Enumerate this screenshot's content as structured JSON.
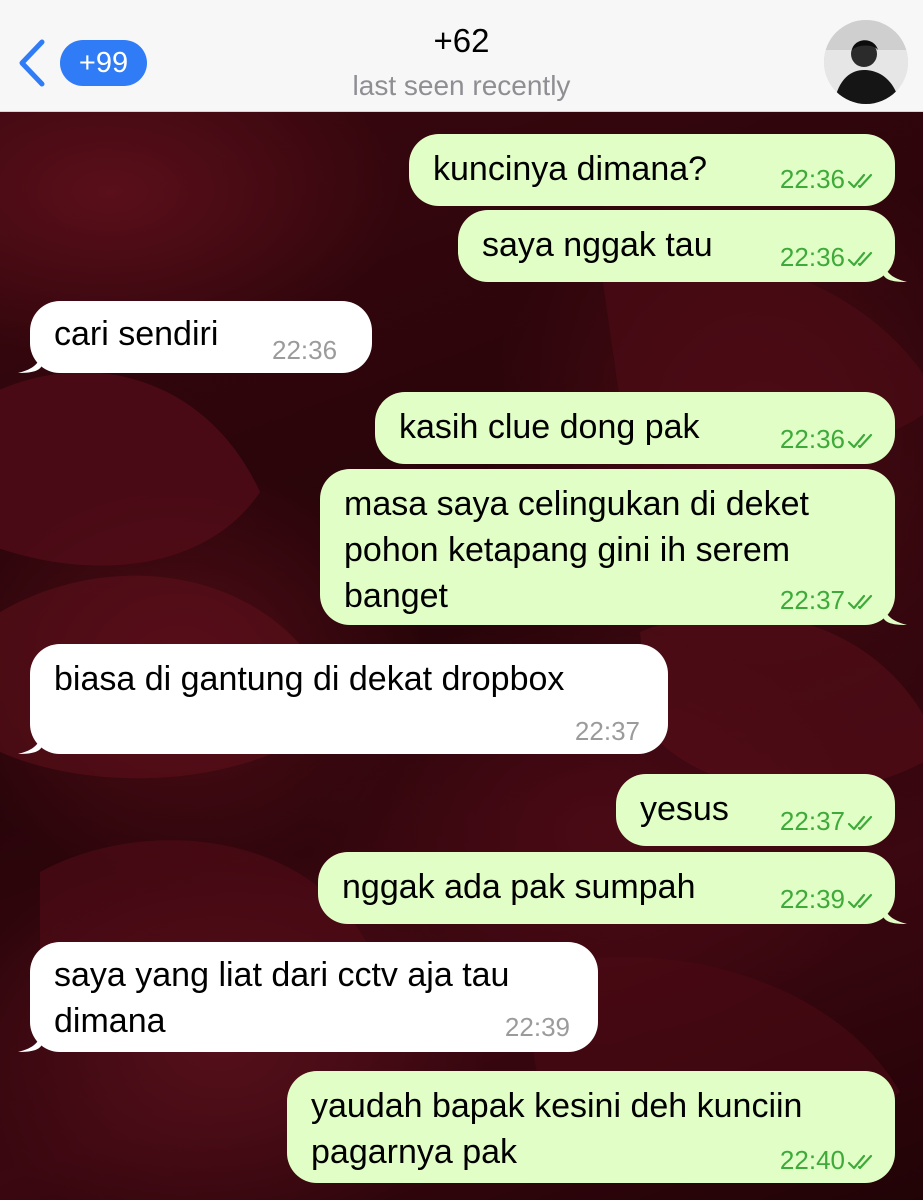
{
  "header": {
    "back_icon": "chevron-left-icon",
    "unread_count": "+99",
    "title": "+62",
    "status": "last seen recently",
    "avatar_icon": "contact-avatar"
  },
  "colors": {
    "header_bg": "#f7f7f7",
    "badge": "#2f7cf6",
    "outgoing_bubble": "#e1fec6",
    "incoming_bubble": "#ffffff",
    "outgoing_time": "#3eaa3a",
    "incoming_time": "#9b9b9b",
    "wallpaper": "#3a070f"
  },
  "messages": [
    {
      "direction": "out",
      "text": "kuncinya dimana?",
      "time": "22:36",
      "read": true
    },
    {
      "direction": "out",
      "text": "saya nggak tau",
      "time": "22:36",
      "read": true
    },
    {
      "direction": "in",
      "text": "cari sendiri",
      "time": "22:36"
    },
    {
      "direction": "out",
      "text": "kasih clue dong pak",
      "time": "22:36",
      "read": true
    },
    {
      "direction": "out",
      "lines": [
        "masa saya celingukan di deket",
        "pohon ketapang gini ih serem",
        "banget"
      ],
      "time": "22:37",
      "read": true
    },
    {
      "direction": "in",
      "text": "biasa di gantung di dekat dropbox",
      "time": "22:37"
    },
    {
      "direction": "out",
      "text": "yesus",
      "time": "22:37",
      "read": true
    },
    {
      "direction": "out",
      "text": "nggak ada pak sumpah",
      "time": "22:39",
      "read": true
    },
    {
      "direction": "in",
      "lines": [
        "saya yang liat dari cctv aja tau",
        "dimana"
      ],
      "time": "22:39"
    },
    {
      "direction": "out",
      "lines": [
        "yaudah bapak kesini deh kunciin",
        "pagarnya pak"
      ],
      "time": "22:40",
      "read": true
    }
  ]
}
